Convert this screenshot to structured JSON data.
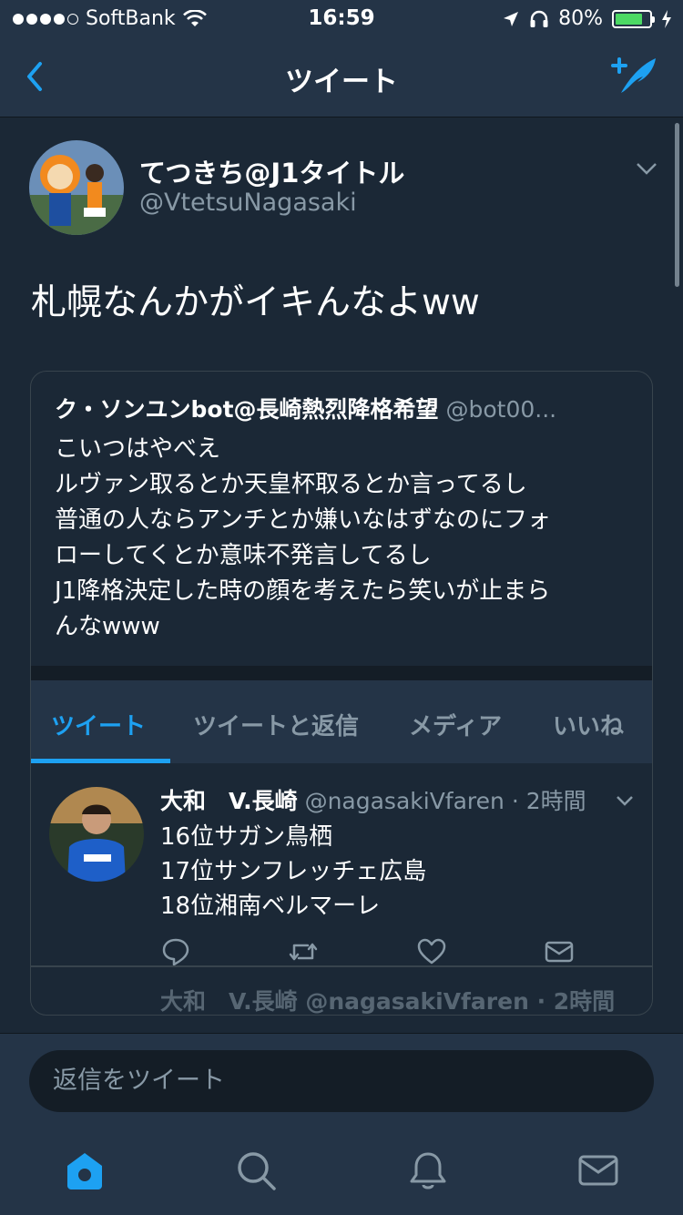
{
  "status": {
    "carrier": "SoftBank",
    "time": "16:59",
    "battery": "80%",
    "battery_level": 0.8,
    "signal_bars": 4
  },
  "nav": {
    "title": "ツイート"
  },
  "tweet": {
    "name": "てつきち@J1タイトル",
    "handle": "@VtetsuNagasaki",
    "text": "札幌なんかがイキんなよww"
  },
  "quote": {
    "name": "ク・ソンユンbot@長崎熱烈降格希望",
    "handle": "@bot00...",
    "lines": [
      "こいつはやべえ",
      "ルヴァン取るとか天皇杯取るとか言ってるし",
      "普通の人ならアンチとか嫌いなはずなのにフォ",
      "ローしてくとか意味不発言してるし",
      "J1降格決定した時の顔を考えたら笑いが止まら",
      "んなwww"
    ],
    "tabs": [
      "ツイート",
      "ツイートと返信",
      "メディア",
      "いいね"
    ],
    "active_tab": 0
  },
  "inner_tweet": {
    "name": "大和　V.長崎",
    "handle_time": "@nagasakiVfaren · 2時間",
    "lines": [
      "16位サガン鳥栖",
      "17位サンフレッチェ広島",
      "18位湘南ベルマーレ"
    ]
  },
  "peek_text": "大和　V.長崎 @nagasakiVfaren · 2時間",
  "reply": {
    "placeholder": "返信をツイート"
  },
  "colors": {
    "accent": "#1da1f2",
    "background": "#1b2836",
    "bar": "#243447",
    "secondary_text": "#8899a6"
  }
}
